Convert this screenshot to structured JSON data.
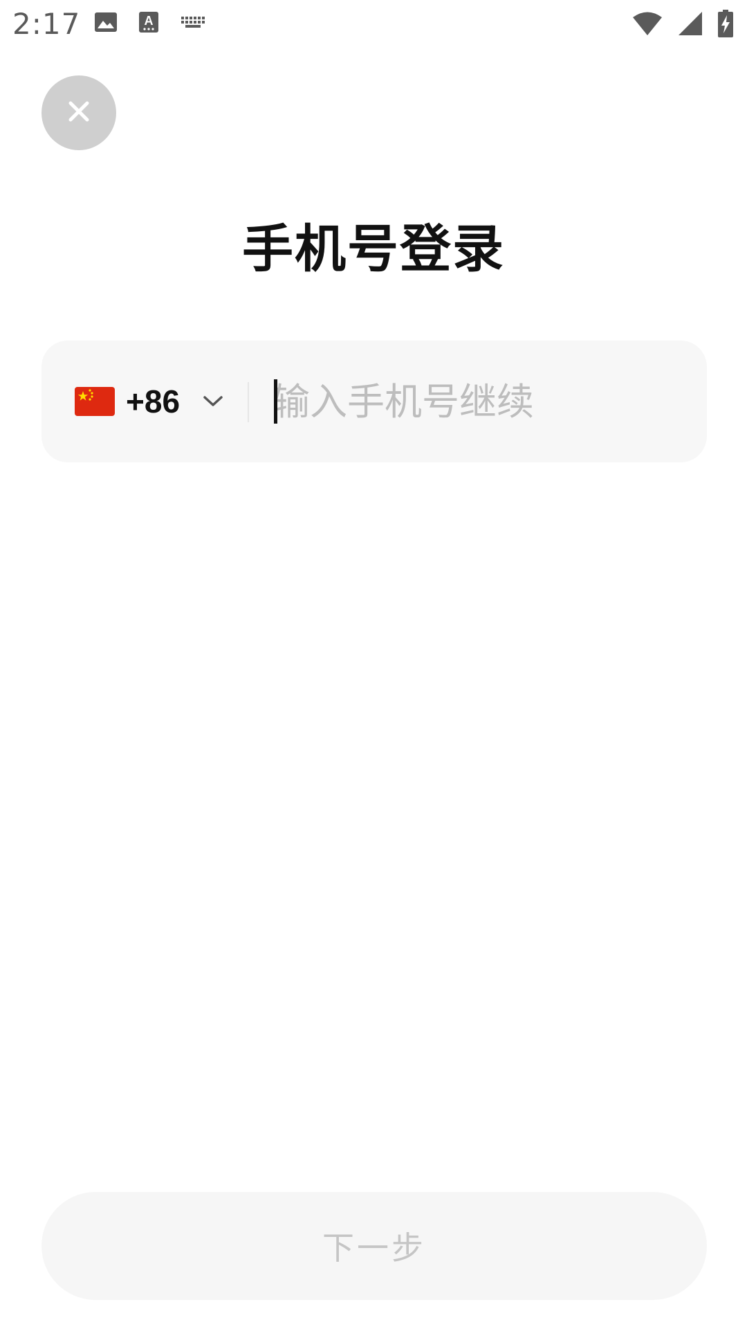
{
  "status_bar": {
    "time": "2:17",
    "left_icons": [
      "image-icon",
      "text-input-icon",
      "keyboard-icon"
    ],
    "right_icons": [
      "wifi-icon",
      "cell-signal-icon",
      "battery-charging-icon"
    ]
  },
  "header": {
    "close_icon": "close-icon"
  },
  "title": "手机号登录",
  "phone_form": {
    "country_flag": "china-flag-icon",
    "country_code": "+86",
    "phone_value": "",
    "phone_placeholder": "输入手机号继续"
  },
  "next_button": {
    "label": "下一步"
  },
  "colors": {
    "background": "#ffffff",
    "close_button_bg": "#cfcfcf",
    "card_bg": "#f7f7f7",
    "placeholder": "#bdbdbd",
    "flag_red": "#de2910",
    "flag_star": "#ffde00",
    "disabled_text": "#c5c5c5"
  }
}
